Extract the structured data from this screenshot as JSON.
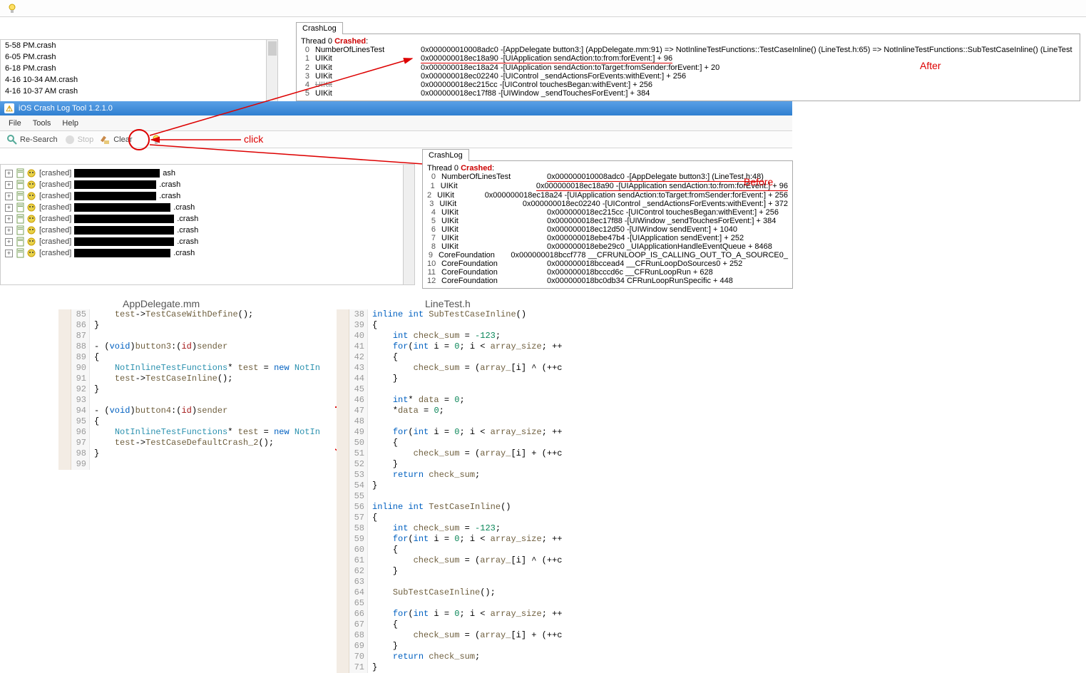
{
  "topfiles": [
    "5-58 PM.crash",
    "6-05 PM.crash",
    "6-18 PM.crash",
    "4-16 10-34 AM.crash",
    "4-16 10-37 AM crash"
  ],
  "crashlog_tab": "CrashLog",
  "thread_header_prefix": "Thread 0 ",
  "thread_header_crashed": "Crashed",
  "thread_header_suffix": ":",
  "after_label": "After",
  "before_label": "Before",
  "click_label": "click",
  "stack_top": [
    {
      "n": "0",
      "m": "NumberOfLinesTest",
      "a": "0x000000010008adc0 -[AppDelegate button3:] (AppDelegate.mm:91) => NotInlineTestFunctions::TestCaseInline() (LineTest.h:65) => NotInlineTestFunctions::SubTestCaseInline() (LineTest"
    },
    {
      "n": "1",
      "m": "UIKit",
      "a": "0x000000018ec18a90 -[UIApplication sendAction:to:from:forEvent:] + 96",
      "ul": true
    },
    {
      "n": "2",
      "m": "UIKit",
      "a": "0x000000018ec18a24 -[UIApplication sendAction:toTarget:fromSender:forEvent:] + 20"
    },
    {
      "n": "3",
      "m": "UIKit",
      "a": "0x000000018ec02240 -[UIControl _sendActionsForEvents:withEvent:] + 256"
    },
    {
      "n": "4",
      "m": "UIKit",
      "a": "0x000000018ec215cc -[UIControl touchesBegan:withEvent:] + 256",
      "strike": true
    },
    {
      "n": "5",
      "m": "UIKit",
      "a": "0x000000018ec17f88 -[UIWindow _sendTouchesForEvent:] + 384"
    }
  ],
  "app_title": "iOS Crash Log Tool 1.2.1.0",
  "menu": {
    "file": "File",
    "tools": "Tools",
    "help": "Help"
  },
  "toolbar": {
    "research": "Re-Search",
    "stop": "Stop",
    "clear": "Clear"
  },
  "tree": [
    {
      "label": "[crashed]",
      "bar": 120,
      "tail": "ash"
    },
    {
      "label": "[crashed]",
      "bar": 115,
      "tail": ".crash"
    },
    {
      "label": "[crashed]",
      "bar": 115,
      "tail": ".crash"
    },
    {
      "label": "[crashed]",
      "bar": 135,
      "tail": ".crash"
    },
    {
      "label": "[crashed]",
      "bar": 140,
      "tail": ".crash"
    },
    {
      "label": "[crashed]",
      "bar": 140,
      "tail": ".crash"
    },
    {
      "label": "[crashed]",
      "bar": 140,
      "tail": ".crash"
    },
    {
      "label": "[crashed]",
      "bar": 135,
      "tail": ".crash"
    }
  ],
  "stack_mid": [
    {
      "n": "0",
      "m": "NumberOfLinesTest",
      "a": "0x000000010008adc0 -[AppDelegate button3:] (LineTest.h:48)",
      "ul": true
    },
    {
      "n": "1",
      "m": "UIKit",
      "a": "0x000000018ec18a90 -[UIApplication sendAction:to:from:forEvent:] + 96",
      "ul": true
    },
    {
      "n": "2",
      "m": "UIKit",
      "a": "0x000000018ec18a24 -[UIApplication sendAction:toTarget:fromSender:forEvent:] + 256"
    },
    {
      "n": "3",
      "m": "UIKit",
      "a": "0x000000018ec02240 -[UIControl _sendActionsForEvents:withEvent:] + 372"
    },
    {
      "n": "4",
      "m": "UIKit",
      "a": "0x000000018ec215cc -[UIControl touchesBegan:withEvent:] + 256"
    },
    {
      "n": "5",
      "m": "UIKit",
      "a": "0x000000018ec17f88 -[UIWindow _sendTouchesForEvent:] + 384"
    },
    {
      "n": "6",
      "m": "UIKit",
      "a": "0x000000018ec12d50 -[UIWindow sendEvent:] + 1040"
    },
    {
      "n": "7",
      "m": "UIKit",
      "a": "0x000000018ebe47b4 -[UIApplication sendEvent:] + 252"
    },
    {
      "n": "8",
      "m": "UIKit",
      "a": "0x000000018ebe29c0 _UIApplicationHandleEventQueue + 8468"
    },
    {
      "n": "9",
      "m": "CoreFoundation",
      "a": "0x000000018bccf778 __CFRUNLOOP_IS_CALLING_OUT_TO_A_SOURCE0_"
    },
    {
      "n": "10",
      "m": "CoreFoundation",
      "a": "0x000000018bccead4 __CFRunLoopDoSources0 + 252"
    },
    {
      "n": "11",
      "m": "CoreFoundation",
      "a": "0x000000018bcccd6c __CFRunLoopRun + 628"
    },
    {
      "n": "12",
      "m": "CoreFoundation",
      "a": "0x000000018bc0db34 CFRunLoopRunSpecific + 448"
    }
  ],
  "code_left": {
    "title": "AppDelegate.mm",
    "start": 85,
    "lines": [
      "    test->TestCaseWithDefine();",
      "}",
      "",
      "- (void)button3:(id)sender",
      "{",
      "    NotInlineTestFunctions* test = new NotIn",
      "    test->TestCaseInline();",
      "}",
      "",
      "- (void)button4:(id)sender",
      "{",
      "    NotInlineTestFunctions* test = new NotIn",
      "    test->TestCaseDefaultCrash_2();",
      "}",
      ""
    ]
  },
  "code_right": {
    "title": "LineTest.h",
    "start": 38,
    "lines": [
      "inline int SubTestCaseInline()",
      "{",
      "    int check_sum = -123;",
      "    for(int i = 0; i < array_size; ++",
      "    {",
      "        check_sum = (array_[i] ^ (++c",
      "    }",
      "",
      "    int* data = 0;",
      "    *data = 0;",
      "",
      "    for(int i = 0; i < array_size; ++",
      "    {",
      "        check_sum = (array_[i] + (++c",
      "    }",
      "    return check_sum;",
      "}",
      "",
      "inline int TestCaseInline()",
      "{",
      "    int check_sum = -123;",
      "    for(int i = 0; i < array_size; ++",
      "    {",
      "        check_sum = (array_[i] ^ (++c",
      "    }",
      "",
      "    SubTestCaseInline();",
      "",
      "    for(int i = 0; i < array_size; ++",
      "    {",
      "        check_sum = (array_[i] + (++c",
      "    }",
      "    return check_sum;",
      "}"
    ]
  }
}
